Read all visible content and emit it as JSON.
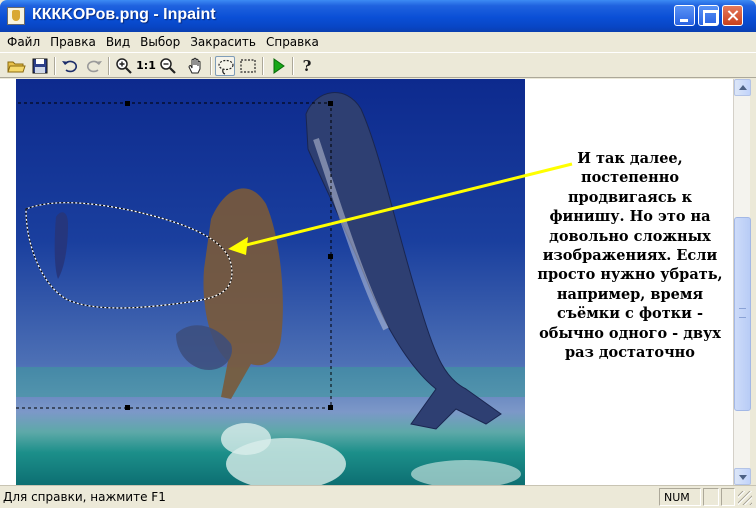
{
  "window": {
    "title": "КККKОРов.png - Inpaint"
  },
  "menu": {
    "items": [
      "Файл",
      "Правка",
      "Вид",
      "Выбор",
      "Закрасить",
      "Справка"
    ]
  },
  "toolbar": {
    "icons": [
      "open-folder-icon",
      "save-icon",
      "undo-icon",
      "redo-icon",
      "zoom-in-icon",
      "actual-size-icon",
      "zoom-out-icon",
      "hand-icon",
      "lasso-icon",
      "rectangle-select-icon",
      "run-icon",
      "help-icon"
    ],
    "actual_size_label": "1:1",
    "help_label": "?"
  },
  "caption": {
    "text": "И так далее,\nпостепенно\nпродвигаясь к\nфинишу. Но это на\nдовольно сложных\nизображениях. Если\nпросто нужно убрать,\nнапример, время\nсъёмки с фотки -\nобычно одного - двух\nраз достаточно"
  },
  "colors": {
    "arrow": "#ffff00",
    "titlebar": "#0a4fd6"
  },
  "statusbar": {
    "help_text": "Для справки, нажмите F1",
    "num_indicator": "NUM"
  }
}
